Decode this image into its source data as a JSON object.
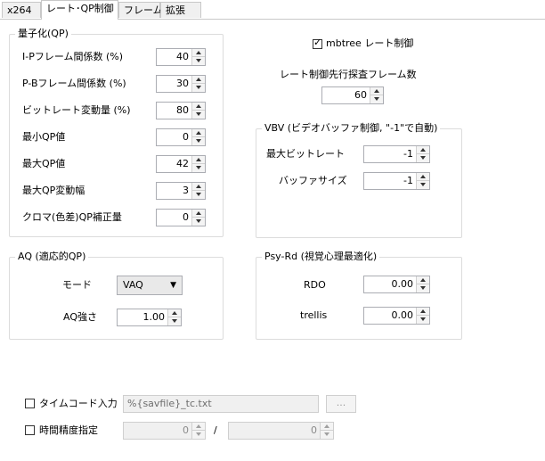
{
  "tabs": [
    {
      "label": "x264"
    },
    {
      "label": "レート･QP制御"
    },
    {
      "label": "フレーム"
    },
    {
      "label": "拡張"
    }
  ],
  "qp_group": {
    "title": "量子化(QP)",
    "rows": [
      {
        "label": "I-Pフレーム間係数 (%)",
        "value": "40"
      },
      {
        "label": "P-Bフレーム間係数 (%)",
        "value": "30"
      },
      {
        "label": "ビットレート変動量 (%)",
        "value": "80"
      },
      {
        "label": "最小QP値",
        "value": "0"
      },
      {
        "label": "最大QP値",
        "value": "42"
      },
      {
        "label": "最大QP変動幅",
        "value": "3"
      },
      {
        "label": "クロマ(色差)QP補正量",
        "value": "0"
      }
    ]
  },
  "mbtree": {
    "label": "mbtree レート制御",
    "checked": true
  },
  "lookahead": {
    "label": "レート制御先行探査フレーム数",
    "value": "60"
  },
  "vbv_group": {
    "title": "VBV (ビデオバッファ制御, \"-1\"で自動)",
    "max_bitrate_label": "最大ビットレート",
    "max_bitrate_value": "-1",
    "buffer_size_label": "バッファサイズ",
    "buffer_size_value": "-1"
  },
  "aq_group": {
    "title": "AQ (適応的QP)",
    "mode_label": "モード",
    "mode_value": "VAQ",
    "strength_label": "AQ強さ",
    "strength_value": "1.00"
  },
  "psy_group": {
    "title": "Psy-Rd (視覚心理最適化)",
    "rdo_label": "RDO",
    "rdo_value": "0.00",
    "trellis_label": "trellis",
    "trellis_value": "0.00"
  },
  "timecode": {
    "label": "タイムコード入力",
    "checked": false,
    "path_value": "%{savfile}_tc.txt",
    "browse_label": "..."
  },
  "time_precision": {
    "label": "時間精度指定",
    "checked": false,
    "numerator": "0",
    "separator": "/",
    "denominator": "0"
  },
  "colors": {
    "border": "#dcdcdc",
    "tab_bg": "#f0f0f0",
    "disabled_bg": "#f0f0f0"
  }
}
